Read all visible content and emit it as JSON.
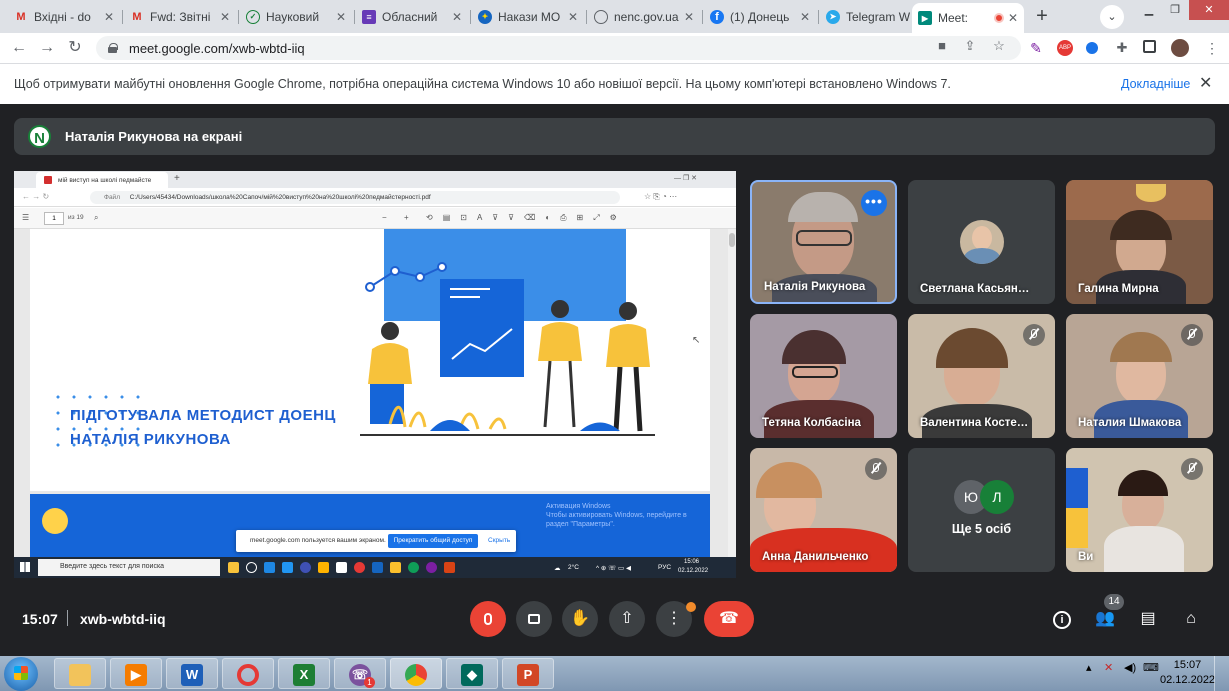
{
  "browser": {
    "tabs": [
      {
        "title": "Вхідні - do",
        "icon": "gmail-icon",
        "color": "#d93025"
      },
      {
        "title": "Fwd: Звітні",
        "icon": "gmail-icon",
        "color": "#d93025"
      },
      {
        "title": "Науковий",
        "icon": "site-icon",
        "color": "#188038"
      },
      {
        "title": "Обласний",
        "icon": "forms-icon",
        "color": "#673ab7"
      },
      {
        "title": "Накази МО",
        "icon": "site-icon",
        "color": "#1565c0"
      },
      {
        "title": "nenc.gov.ua",
        "icon": "globe-icon",
        "color": "#5f6368"
      },
      {
        "title": "(1) Донець",
        "icon": "facebook-icon",
        "color": "#1877f2"
      },
      {
        "title": "Telegram W",
        "icon": "telegram-icon",
        "color": "#29a9eb"
      },
      {
        "title": "Meet:",
        "icon": "meet-icon",
        "color": "#00897b",
        "active": true
      }
    ],
    "url": "meet.google.com/xwb-wbtd-iiq"
  },
  "infobar": {
    "message": "Щоб отримувати майбутні оновлення Google Chrome, потрібна операційна система Windows 10 або новішої версії. На цьому комп'ютері встановлено Windows 7.",
    "link": "Докладніше"
  },
  "presenter": {
    "initial": "N",
    "text": "Наталія Рикунова на екрані"
  },
  "shared_screen": {
    "tab_title": "мій виступ на школі педмайсте",
    "file_path": "C:/Users/45434/Downloads/школа%20Сапоч/мій%20виступ%20на%20школі%20педмайстерності.pdf",
    "file_label": "Файл",
    "page_number": "1",
    "page_of": "из 19",
    "headline_1": "ПІДГОТУВАЛА МЕТОДИСТ ДОЕНЦ",
    "headline_2": "НАТАЛІЯ РИКУНОВА",
    "page2_text_1": "Активация Windows",
    "page2_text_2": "Чтобы активировать Windows, перейдите в",
    "page2_text_3": "раздел \"Параметры\".",
    "share_notice": "meet.google.com пользуется вашим экраном.",
    "share_stop": "Прекратить общий доступ",
    "share_hide": "Скрыть",
    "taskbar_search": "Введите здесь текст для поиска",
    "tray_temp": "2°C",
    "tray_lang": "РУС",
    "tray_time": "15:06",
    "tray_date": "02.12.2022"
  },
  "participants": [
    {
      "name": "Наталія Рикунова",
      "muted": false,
      "speaking": true
    },
    {
      "name": "Светлана Касьян…",
      "muted": false,
      "avatar": true
    },
    {
      "name": "Галина Мирна",
      "muted": false
    },
    {
      "name": "Тетяна Колбасіна",
      "muted": false
    },
    {
      "name": "Валентина Косте…",
      "muted": true
    },
    {
      "name": "Наталия Шмакова",
      "muted": true
    },
    {
      "name": "Анна Данильченко",
      "muted": true
    },
    {
      "name": "Ще 5 осіб",
      "initials": [
        "Ю",
        "Л"
      ]
    },
    {
      "name": "Ви",
      "muted": true
    }
  ],
  "controls": {
    "time": "15:07",
    "meeting_code": "xwb-wbtd-iiq",
    "people_count": "14"
  },
  "windows": {
    "clock_time": "15:07",
    "clock_date": "02.12.2022",
    "viber_badge": "1"
  }
}
